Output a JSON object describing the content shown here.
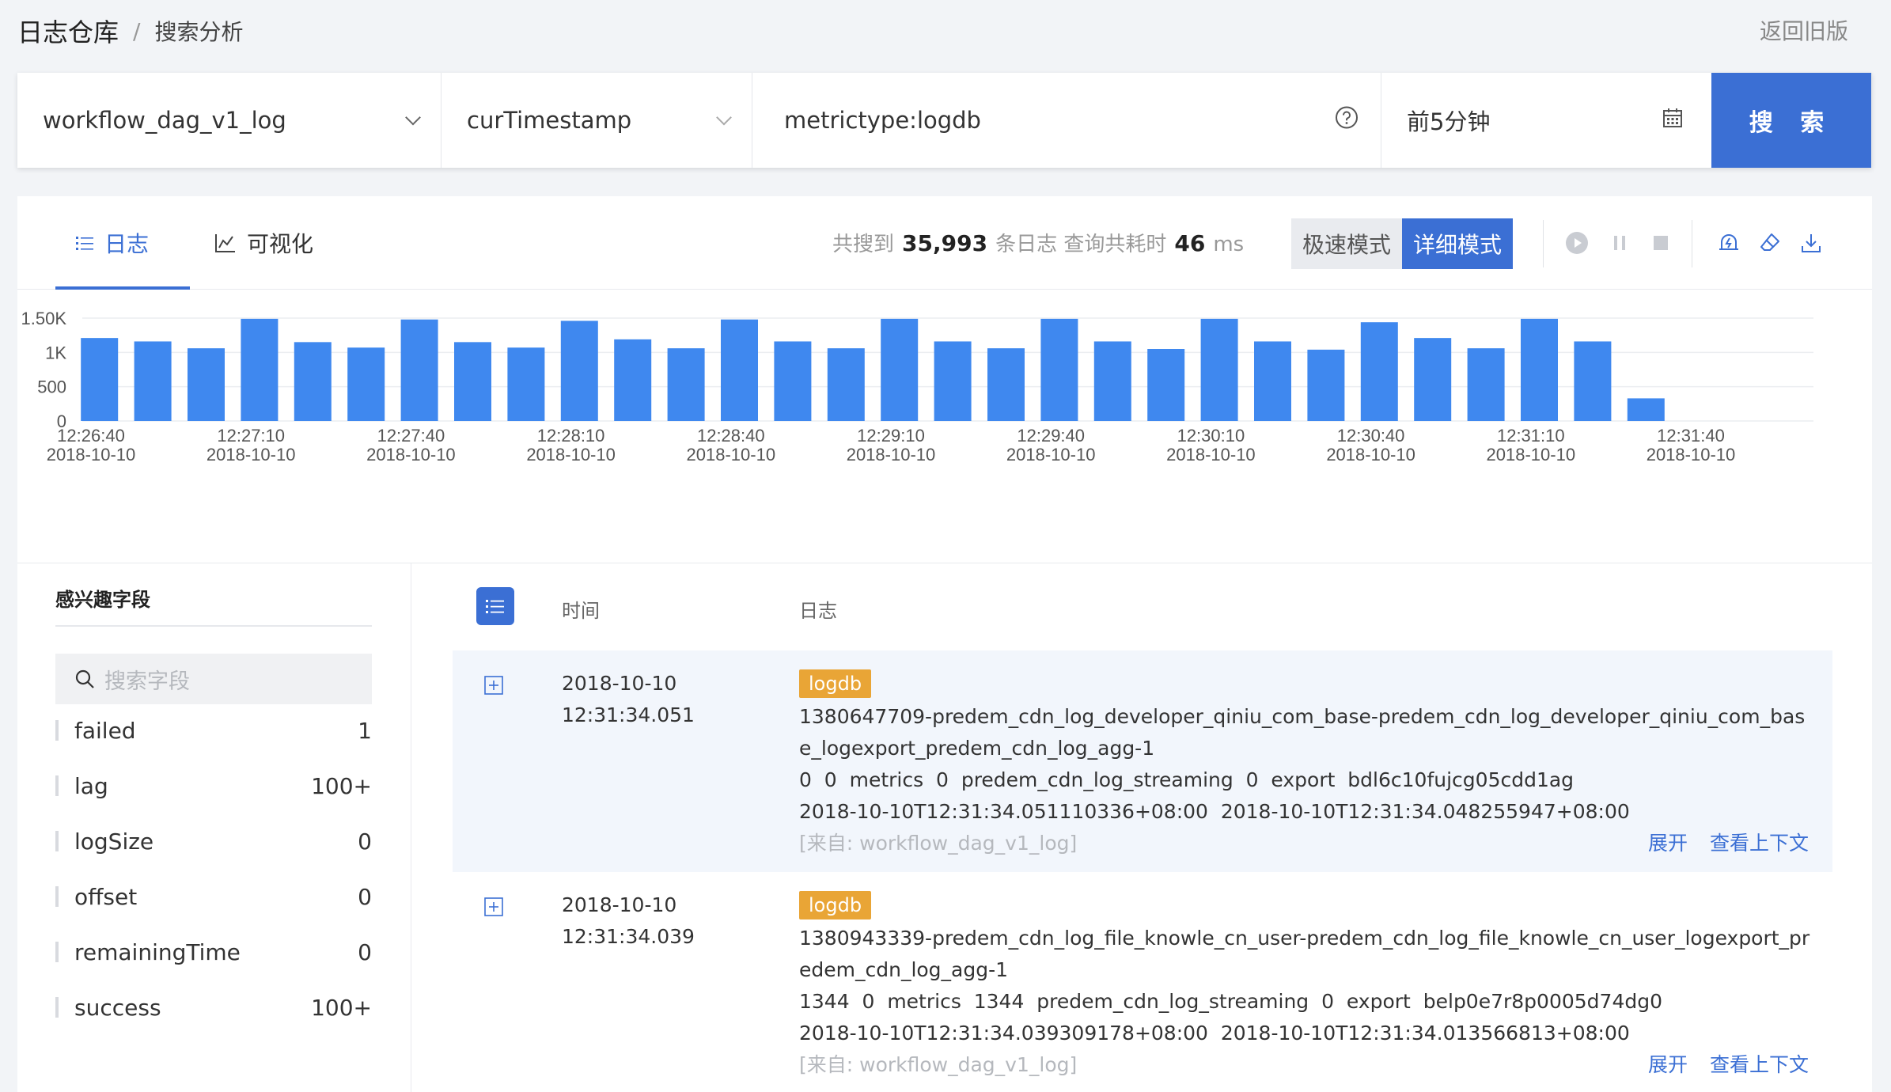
{
  "breadcrumb": {
    "root": "日志仓库",
    "separator": "/",
    "current": "搜索分析"
  },
  "back_old": "返回旧版",
  "search": {
    "repo": "workflow_dag_v1_log",
    "time_field": "curTimestamp",
    "query": "metrictype:logdb",
    "range": "前5分钟",
    "button": "搜 索"
  },
  "tabs": {
    "logs": "日志",
    "viz": "可视化"
  },
  "stats": {
    "prefix": "共搜到",
    "count": "35,993",
    "mid": "条日志 查询共耗时",
    "ms": "46",
    "unit": "ms"
  },
  "modes": {
    "fast": "极速模式",
    "detail": "详细模式"
  },
  "chart_data": {
    "type": "bar",
    "y_ticks": [
      "1.50K",
      "1K",
      "500",
      "0"
    ],
    "ylim": [
      0,
      1500
    ],
    "x_tick_labels": [
      [
        "12:26:40",
        "2018-10-10"
      ],
      [
        "12:27:10",
        "2018-10-10"
      ],
      [
        "12:27:40",
        "2018-10-10"
      ],
      [
        "12:28:10",
        "2018-10-10"
      ],
      [
        "12:28:40",
        "2018-10-10"
      ],
      [
        "12:29:10",
        "2018-10-10"
      ],
      [
        "12:29:40",
        "2018-10-10"
      ],
      [
        "12:30:10",
        "2018-10-10"
      ],
      [
        "12:30:40",
        "2018-10-10"
      ],
      [
        "12:31:10",
        "2018-10-10"
      ],
      [
        "12:31:40",
        "2018-10-10"
      ]
    ],
    "values": [
      1210,
      1160,
      1060,
      1490,
      1150,
      1070,
      1480,
      1150,
      1070,
      1460,
      1190,
      1060,
      1480,
      1160,
      1060,
      1490,
      1160,
      1060,
      1490,
      1160,
      1050,
      1490,
      1160,
      1040,
      1440,
      1210,
      1060,
      1490,
      1160,
      330
    ],
    "color": "#3f88ef"
  },
  "fields": {
    "title": "感兴趣字段",
    "search_placeholder": "搜索字段",
    "items": [
      {
        "name": "failed",
        "count": "1"
      },
      {
        "name": "lag",
        "count": "100+"
      },
      {
        "name": "logSize",
        "count": "0"
      },
      {
        "name": "offset",
        "count": "0"
      },
      {
        "name": "remainingTime",
        "count": "0"
      },
      {
        "name": "success",
        "count": "100+"
      }
    ]
  },
  "log_headers": {
    "time": "时间",
    "log": "日志"
  },
  "logs": [
    {
      "date": "2018-10-10",
      "time": "12:31:34.051",
      "tag": "logdb",
      "line1": "1380647709-predem_cdn_log_developer_qiniu_com_base-predem_cdn_log_developer_qiniu_com_base_logexport_predem_cdn_log_agg-1",
      "line2": "0  0  metrics  0  predem_cdn_log_streaming  0  export  bdl6c10fujcg05cdd1ag",
      "line3": "2018-10-10T12:31:34.051110336+08:00  2018-10-10T12:31:34.048255947+08:00",
      "source": "[来自: workflow_dag_v1_log]",
      "expand": "展开",
      "context": "查看上下文"
    },
    {
      "date": "2018-10-10",
      "time": "12:31:34.039",
      "tag": "logdb",
      "line1": "1380943339-predem_cdn_log_file_knowle_cn_user-predem_cdn_log_file_knowle_cn_user_logexport_predem_cdn_log_agg-1",
      "line2": "1344  0  metrics  1344  predem_cdn_log_streaming  0  export  belp0e7r8p0005d74dg0",
      "line3": "2018-10-10T12:31:34.039309178+08:00  2018-10-10T12:31:34.013566813+08:00",
      "source": "[来自: workflow_dag_v1_log]",
      "expand": "展开",
      "context": "查看上下文"
    }
  ]
}
